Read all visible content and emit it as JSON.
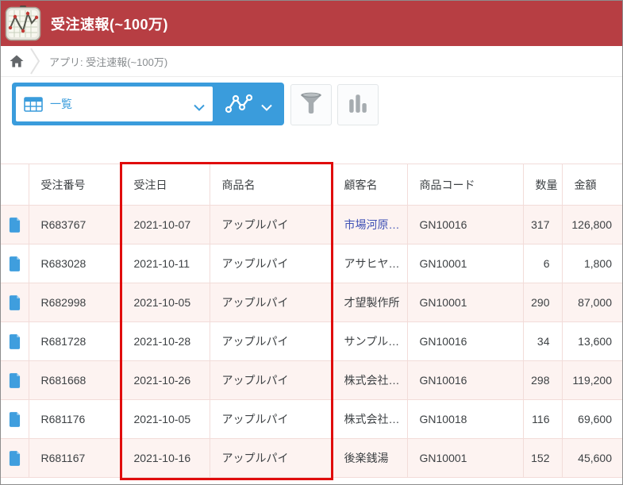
{
  "app_header": {
    "title": "受注速報(~100万)",
    "icon": "line-chart-app-icon",
    "background_color": "#b73e43"
  },
  "breadcrumb": {
    "home_icon": "home-icon",
    "label": "アプリ: 受注速報(~100万)"
  },
  "toolbar": {
    "view_selector": {
      "icon": "table-view-icon",
      "selected_view": "一覧",
      "dropdown_icon": "chevron-down-icon"
    },
    "chart_switcher": {
      "icon": "line-chart-icon",
      "dropdown_icon": "chevron-down-icon"
    },
    "filter_button": {
      "icon": "funnel-icon"
    },
    "graph_button": {
      "icon": "bar-chart-icon"
    }
  },
  "table": {
    "columns": [
      "",
      "受注番号",
      "受注日",
      "商品名",
      "顧客名",
      "商品コード",
      "数量",
      "金額"
    ],
    "rows": [
      {
        "order_no": "R683767",
        "order_date": "2021-10-07",
        "product_name": "アップルパイ",
        "customer": "市場河原…",
        "product_code": "GN10016",
        "quantity": "317",
        "amount": "126,800"
      },
      {
        "order_no": "R683028",
        "order_date": "2021-10-11",
        "product_name": "アップルパイ",
        "customer": "アサヒヤ…",
        "product_code": "GN10001",
        "quantity": "6",
        "amount": "1,800"
      },
      {
        "order_no": "R682998",
        "order_date": "2021-10-05",
        "product_name": "アップルパイ",
        "customer": "才望製作所",
        "product_code": "GN10001",
        "quantity": "290",
        "amount": "87,000"
      },
      {
        "order_no": "R681728",
        "order_date": "2021-10-28",
        "product_name": "アップルパイ",
        "customer": "サンプル…",
        "product_code": "GN10016",
        "quantity": "34",
        "amount": "13,600"
      },
      {
        "order_no": "R681668",
        "order_date": "2021-10-26",
        "product_name": "アップルパイ",
        "customer": "株式会社…",
        "product_code": "GN10016",
        "quantity": "298",
        "amount": "119,200"
      },
      {
        "order_no": "R681176",
        "order_date": "2021-10-05",
        "product_name": "アップルパイ",
        "customer": "株式会社…",
        "product_code": "GN10018",
        "quantity": "116",
        "amount": "69,600"
      },
      {
        "order_no": "R681167",
        "order_date": "2021-10-16",
        "product_name": "アップルパイ",
        "customer": "後楽銭湯",
        "product_code": "GN10001",
        "quantity": "152",
        "amount": "45,600"
      }
    ]
  },
  "annotation": {
    "type": "red-highlight-rectangle",
    "highlighted_columns": [
      "受注日",
      "商品名"
    ],
    "color": "#e00c0c"
  },
  "colors": {
    "header_red": "#b73e43",
    "accent_blue": "#3a9cdc",
    "row_pink": "#fdf3f1",
    "border_pink": "#f2dcd9",
    "link_blue": "#3f51b5"
  }
}
